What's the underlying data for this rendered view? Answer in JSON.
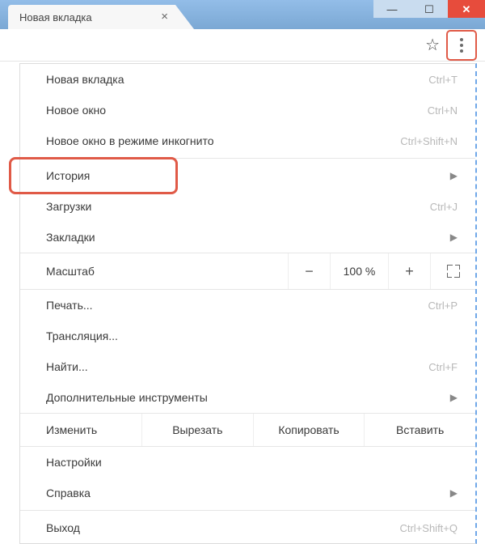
{
  "tab": {
    "title": "Новая вкладка"
  },
  "menu": {
    "new_tab": {
      "label": "Новая вкладка",
      "shortcut": "Ctrl+T"
    },
    "new_window": {
      "label": "Новое окно",
      "shortcut": "Ctrl+N"
    },
    "incognito": {
      "label": "Новое окно в режиме инкогнито",
      "shortcut": "Ctrl+Shift+N"
    },
    "history": {
      "label": "История"
    },
    "downloads": {
      "label": "Загрузки",
      "shortcut": "Ctrl+J"
    },
    "bookmarks": {
      "label": "Закладки"
    },
    "zoom": {
      "label": "Масштаб",
      "value": "100 %"
    },
    "print": {
      "label": "Печать...",
      "shortcut": "Ctrl+P"
    },
    "cast": {
      "label": "Трансляция..."
    },
    "find": {
      "label": "Найти...",
      "shortcut": "Ctrl+F"
    },
    "more_tools": {
      "label": "Дополнительные инструменты"
    },
    "edit": {
      "label": "Изменить",
      "cut": "Вырезать",
      "copy": "Копировать",
      "paste": "Вставить"
    },
    "settings": {
      "label": "Настройки"
    },
    "help": {
      "label": "Справка"
    },
    "exit": {
      "label": "Выход",
      "shortcut": "Ctrl+Shift+Q"
    }
  }
}
